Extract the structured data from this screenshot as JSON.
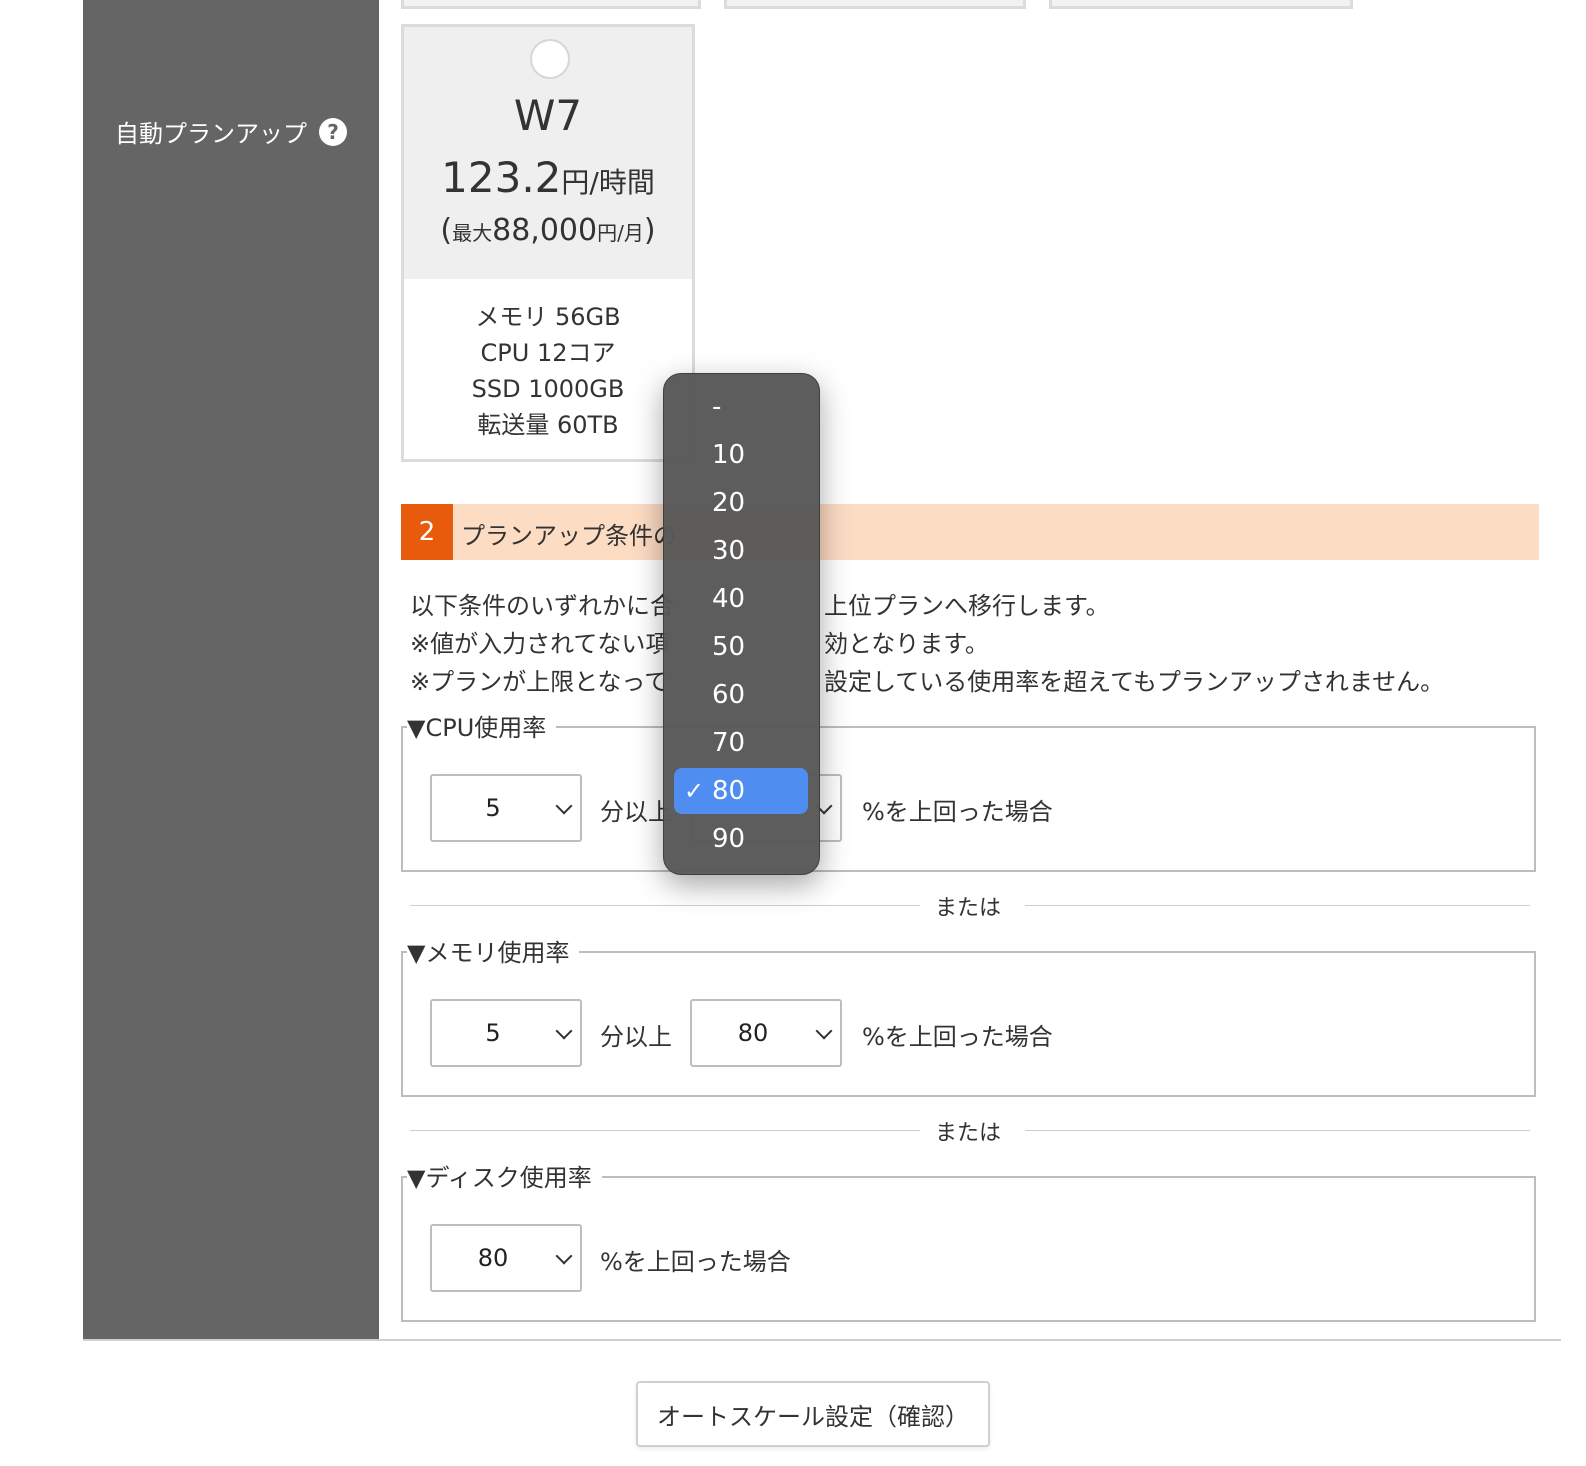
{
  "sidebar": {
    "label": "自動プランアップ",
    "help_icon": "?"
  },
  "plan": {
    "name": "W7",
    "price_value": "123.2",
    "price_unit": "円/時間",
    "max_open": "(",
    "max_label": "最大",
    "max_value": "88,000",
    "max_unit": "円/月",
    "max_close": ")",
    "specs": [
      "メモリ 56GB",
      "CPU 12コア",
      "SSD 1000GB",
      "転送量 60TB"
    ]
  },
  "section": {
    "number": "2",
    "title": "プランアップ条件の"
  },
  "description": [
    "以下条件のいずれかに合",
    "上位プランへ移行します。",
    "※値が入力されてない項",
    "効となります。",
    "※プランが上限となって",
    "設定している使用率を超えてもプランアップされません。"
  ],
  "groups": {
    "cpu": {
      "legend": "▼CPU使用率",
      "minutes": "5",
      "minutes_suffix": "分以上",
      "percent_suffix": "%を上回った場合"
    },
    "memory": {
      "legend": "▼メモリ使用率",
      "minutes": "5",
      "minutes_suffix": "分以上",
      "percent": "80",
      "percent_suffix": "%を上回った場合"
    },
    "disk": {
      "legend": "▼ディスク使用率",
      "percent": "80",
      "percent_suffix": "%を上回った場合"
    }
  },
  "or_text": "または",
  "confirm_button": "オートスケール設定（確認）",
  "dropdown": {
    "options": [
      "-",
      "10",
      "20",
      "30",
      "40",
      "50",
      "60",
      "70",
      "80",
      "90"
    ],
    "selected": "80",
    "check": "✓"
  }
}
